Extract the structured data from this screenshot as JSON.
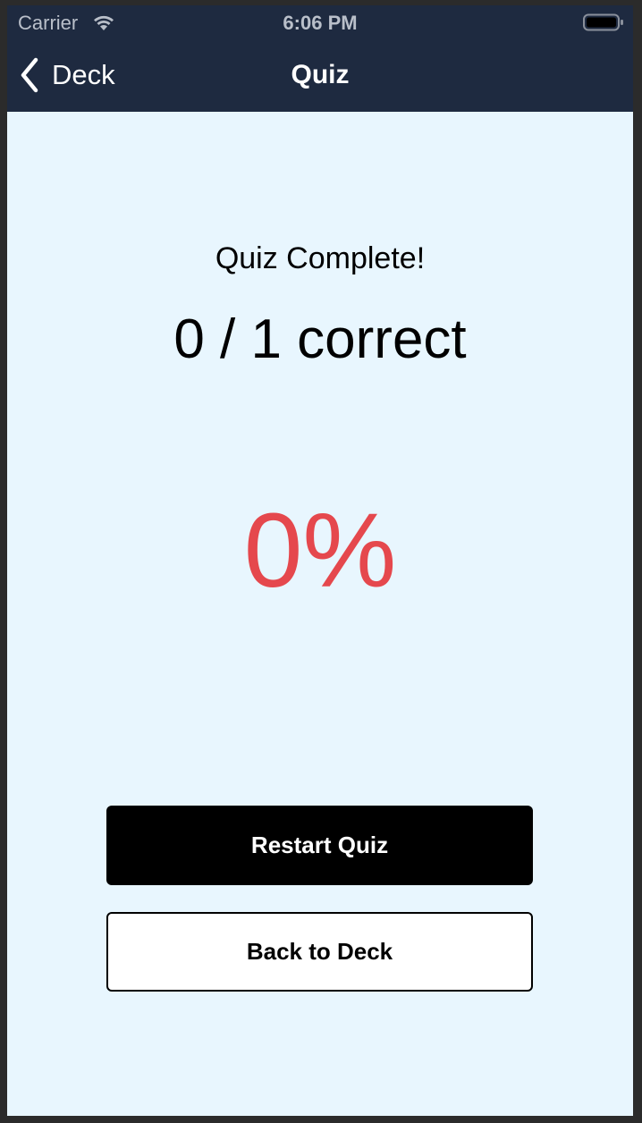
{
  "status_bar": {
    "carrier": "Carrier",
    "time": "6:06 PM",
    "icons": [
      "wifi-icon",
      "battery-icon"
    ]
  },
  "nav": {
    "back_label": "Deck",
    "back_icon": "chevron-left-icon",
    "title": "Quiz"
  },
  "result": {
    "heading": "Quiz Complete!",
    "score_text": "0 / 1 correct",
    "percent_text": "0%"
  },
  "buttons": {
    "restart_label": "Restart Quiz",
    "back_to_deck_label": "Back to Deck"
  },
  "colors": {
    "header_bg": "#1e2a40",
    "page_bg": "#e8f6fe",
    "percent": "#e5484d"
  }
}
